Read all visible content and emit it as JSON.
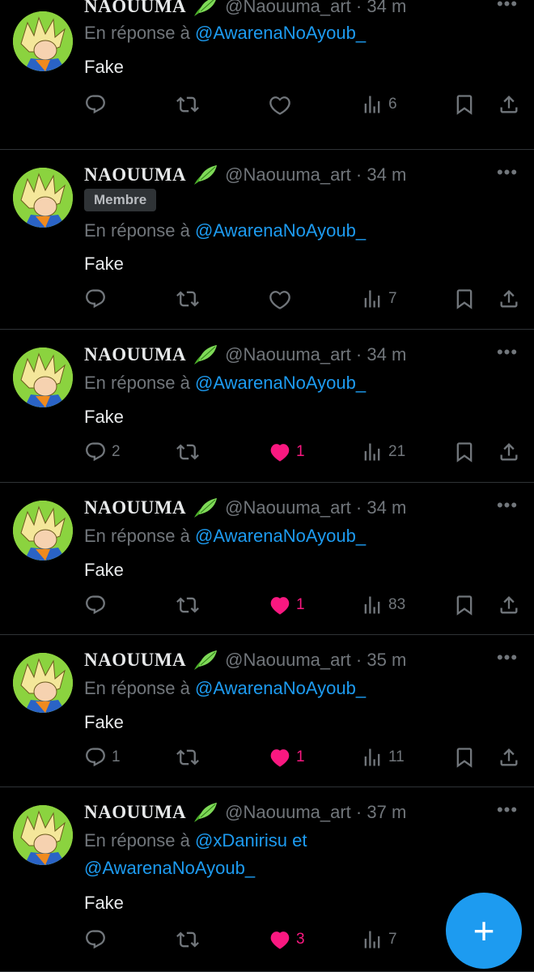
{
  "tweets": [
    {
      "name": "NAOUUMA",
      "handle": "@Naouuma_art",
      "time": "34 m",
      "badge": "",
      "reply_prefix": "En réponse à",
      "reply_to": "@AwarenaNoAyoub_",
      "reply_to_2": "",
      "text": "Fake",
      "replies": "",
      "likes": "",
      "views": "6",
      "liked": false
    },
    {
      "name": "NAOUUMA",
      "handle": "@Naouuma_art",
      "time": "34 m",
      "badge": "Membre",
      "reply_prefix": "En réponse à",
      "reply_to": "@AwarenaNoAyoub_",
      "reply_to_2": "",
      "text": "Fake",
      "replies": "",
      "likes": "",
      "views": "7",
      "liked": false
    },
    {
      "name": "NAOUUMA",
      "handle": "@Naouuma_art",
      "time": "34 m",
      "badge": "",
      "reply_prefix": "En réponse à",
      "reply_to": "@AwarenaNoAyoub_",
      "reply_to_2": "",
      "text": "Fake",
      "replies": "2",
      "likes": "1",
      "views": "21",
      "liked": true
    },
    {
      "name": "NAOUUMA",
      "handle": "@Naouuma_art",
      "time": "34 m",
      "badge": "",
      "reply_prefix": "En réponse à",
      "reply_to": "@AwarenaNoAyoub_",
      "reply_to_2": "",
      "text": "Fake",
      "replies": "",
      "likes": "1",
      "views": "83",
      "liked": true
    },
    {
      "name": "NAOUUMA",
      "handle": "@Naouuma_art",
      "time": "35 m",
      "badge": "",
      "reply_prefix": "En réponse à",
      "reply_to": "@AwarenaNoAyoub_",
      "reply_to_2": "",
      "text": "Fake",
      "replies": "1",
      "likes": "1",
      "views": "11",
      "liked": true
    },
    {
      "name": "NAOUUMA",
      "handle": "@Naouuma_art",
      "time": "37 m",
      "badge": "",
      "reply_prefix": "En réponse à",
      "reply_to": "@xDanirisu et",
      "reply_to_2": "@AwarenaNoAyoub_",
      "text": "Fake",
      "replies": "",
      "likes": "3",
      "views": "7",
      "liked": true
    }
  ],
  "fab": {
    "label": "+",
    "icon": "compose-plus-icon"
  },
  "colors": {
    "accent": "#1d9bf0",
    "like": "#f91880",
    "muted": "#71767b",
    "background": "#000000"
  }
}
